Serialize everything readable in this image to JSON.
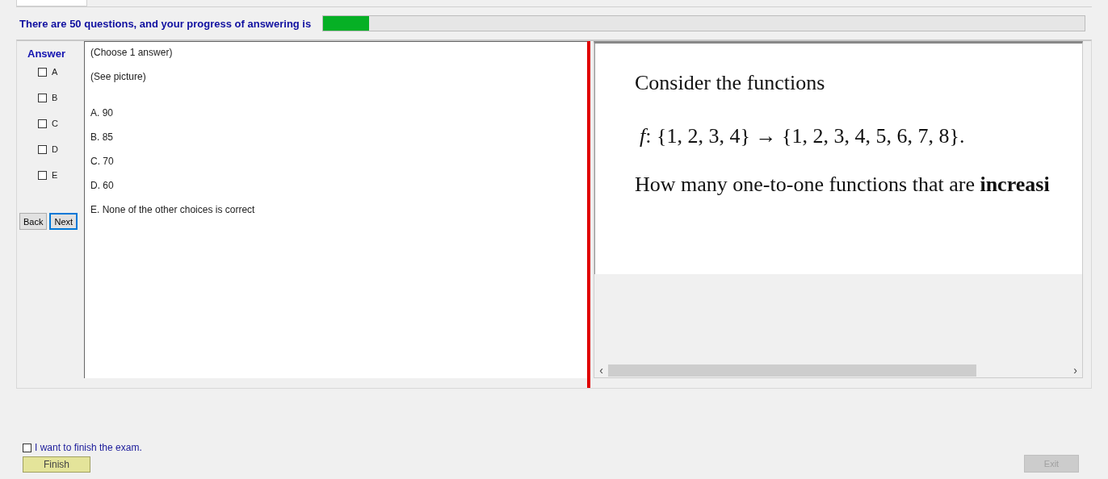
{
  "header": {
    "text": "There are 50 questions, and your progress of answering is",
    "progress": {
      "level": 0.06
    }
  },
  "answer_panel": {
    "title": "Answer",
    "options": [
      {
        "label": "A",
        "checked": false
      },
      {
        "label": "B",
        "checked": false
      },
      {
        "label": "C",
        "checked": false
      },
      {
        "label": "D",
        "checked": false
      },
      {
        "label": "E",
        "checked": false
      }
    ],
    "buttons": [
      {
        "label": "Back",
        "focused": false
      },
      {
        "label": "Next",
        "focused": true
      }
    ]
  },
  "question": {
    "lines": [
      "(Choose 1 answer)",
      "(See picture)"
    ],
    "choices": [
      "A.  90",
      "B.  85",
      "C.  70",
      "D.  60",
      "E.  None of the other choices is correct"
    ]
  },
  "picture": {
    "lines": [
      "Consider the functions",
      "*f*: {1, 2, 3, 4} → {1, 2, 3, 4, 5, 6, 7, 8}.",
      "How many one-to-one functions that are **increasi**"
    ],
    "scroll_left": "‹",
    "scroll_right": "›"
  },
  "finish": {
    "checkbox": {
      "label": "I want to finish the exam.",
      "checked": false
    },
    "button": "Finish"
  },
  "exit_button": {
    "label": "Exit",
    "disabled": true
  }
}
